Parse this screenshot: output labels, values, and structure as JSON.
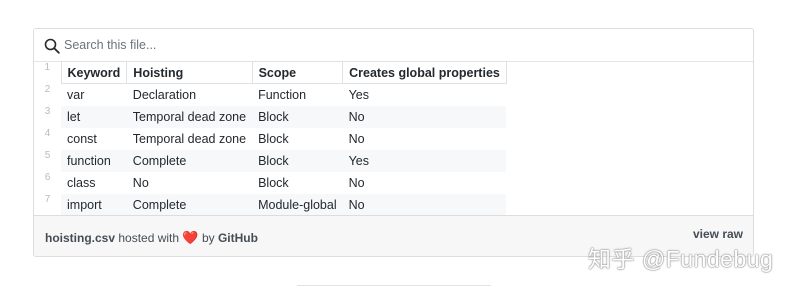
{
  "search": {
    "placeholder": "Search this file..."
  },
  "table": {
    "line_numbers": [
      "1",
      "2",
      "3",
      "4",
      "5",
      "6",
      "7"
    ],
    "headers": [
      "Keyword",
      "Hoisting",
      "Scope",
      "Creates global properties"
    ],
    "rows": [
      [
        "var",
        "Declaration",
        "Function",
        "Yes"
      ],
      [
        "let",
        "Temporal dead zone",
        "Block",
        "No"
      ],
      [
        "const",
        "Temporal dead zone",
        "Block",
        "No"
      ],
      [
        "function",
        "Complete",
        "Block",
        "Yes"
      ],
      [
        "class",
        "No",
        "Block",
        "No"
      ],
      [
        "import",
        "Complete",
        "Module-global",
        "No"
      ]
    ]
  },
  "footer": {
    "filename": "hoisting.csv",
    "hosted_with": "hosted with",
    "heart": "❤️",
    "by": "by",
    "host": "GitHub",
    "view_raw": "view raw"
  },
  "watermark": "知乎 @Fundebug",
  "colors": {
    "heart": "#d73a49",
    "border": "#dddddd",
    "footer_bg": "#f7f7f7",
    "stripe": "#f6f8fa"
  },
  "icons": {
    "search": "search-icon"
  }
}
